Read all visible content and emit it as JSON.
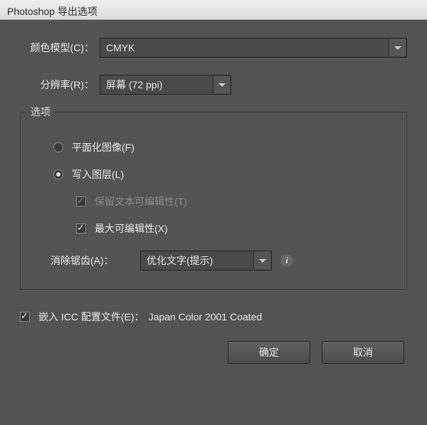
{
  "title": "Photoshop 导出选项",
  "colorModel": {
    "label": "颜色模型(C)：",
    "value": "CMYK"
  },
  "resolution": {
    "label": "分辨率(R)：",
    "value": "屏幕 (72 ppi)"
  },
  "options": {
    "legend": "选项",
    "flatten": {
      "label": "平面化图像(F)",
      "checked": false
    },
    "writeLayers": {
      "label": "写入图层(L)",
      "checked": true
    },
    "preserveText": {
      "label": "保留文本可编辑性(T)",
      "checked": true,
      "enabled": false
    },
    "maxEdit": {
      "label": "最大可编辑性(X)",
      "checked": true
    },
    "antiAlias": {
      "label": "消除锯齿(A)：",
      "value": "优化文字(提示)"
    }
  },
  "embedICC": {
    "label": "嵌入 ICC 配置文件(E)：",
    "value": "Japan Color 2001 Coated",
    "checked": true
  },
  "buttons": {
    "ok": "确定",
    "cancel": "取消"
  }
}
